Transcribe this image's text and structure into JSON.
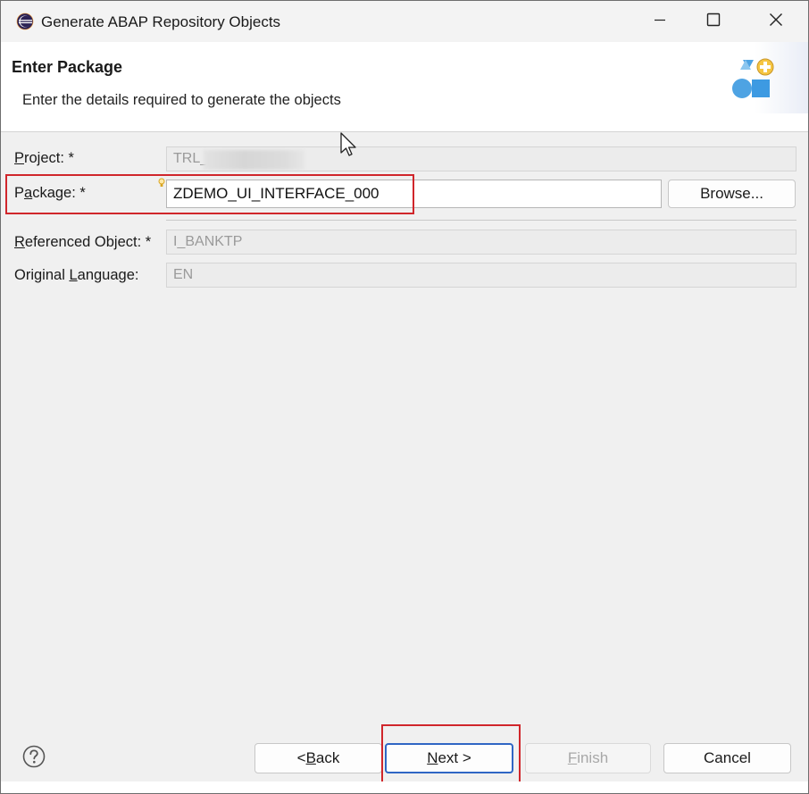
{
  "window": {
    "title": "Generate ABAP Repository Objects",
    "icon": "eclipse-icon",
    "controls": [
      "minimize-icon",
      "maximize-icon",
      "close-icon"
    ]
  },
  "banner": {
    "title": "Enter Package",
    "description": "Enter the details required to generate the objects",
    "icon": "generate-objects-wizard-icon"
  },
  "form": {
    "project": {
      "mnemonic": "P",
      "label_rest": "roject: *",
      "value": "TRL_"
    },
    "package": {
      "label_pre": "P",
      "mnemonic": "a",
      "label_rest": "ckage: *",
      "value": "ZDEMO_UI_INTERFACE_000"
    },
    "browse_pre": "Browse",
    "browse_post": "...",
    "referenced_object": {
      "mnemonic": "R",
      "label_rest": "eferenced Object: *",
      "value": "I_BANKTP"
    },
    "original_language": {
      "label_pre": "Original ",
      "mnemonic": "L",
      "label_rest": "anguage:",
      "value": "EN"
    }
  },
  "footer": {
    "help_icon": "help-icon",
    "back": {
      "pre": "< ",
      "mnemonic": "B",
      "rest": "ack"
    },
    "next": {
      "mnemonic": "N",
      "rest": "ext >"
    },
    "finish": {
      "mnemonic": "F",
      "rest": "inish"
    },
    "cancel": "Cancel"
  },
  "colors": {
    "highlight": "#d0262b",
    "default_button_border": "#2f66c4"
  }
}
